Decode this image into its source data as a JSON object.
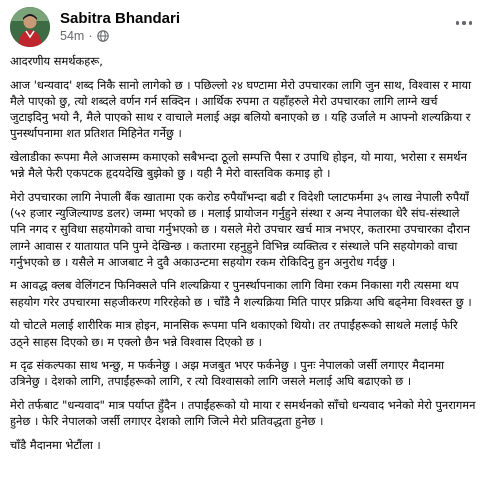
{
  "post": {
    "author": "Sabitra Bhandari",
    "timestamp": "54m",
    "separator": "·",
    "paragraphs": [
      "आदरणीय समर्थकहरू,",
      "आज 'धन्यवाद' शब्द निकै सानो लागेको छ । पछिल्लो २४ घण्टामा मेरो उपचारका लागि जुन साथ, विश्वास र माया मैले पाएको छु, त्यो शब्दले वर्णन गर्न सक्दिन । आर्थिक रुपमा त यहाँहरुले मेरो उपचारका लागि लाग्ने खर्च जुटाइदिनु भयो नै, मैले पाएको साथ र वाचाले मलाई अझ बलियो बनाएको छ । यहि उर्जाले म आफ्नो शल्यक्रिया र पुनर्स्थापनामा शत प्रतिशत मिहिनेत गर्नेछु ।",
      "खेलाडीका रूपमा मैले आजसम्म कमाएको सबैभन्दा ठूलो सम्पत्ति पैसा र उपाधि होइन, यो माया, भरोसा र समर्थन भन्ने मैले फेरी एकपटक हृदयदेखि बुझेको छु । यही नै मेरो वास्तविक कमाइ हो ।",
      "मेरो उपचारका लागि नेपाली बैंक खातामा एक करोड रुपैयाँभन्दा बढी र विदेशी प्लाटफर्ममा ३५ लाख नेपाली रुपैयाँ (५२ हजार न्युजिल्याण्ड डलर) जम्मा भएको छ । मलाई प्रायोजन गर्नुहुने संस्था र अन्य नेपालका धेरै संघ-संस्थाले पनि नगद र सुविधा सहयोगको वाचा गर्नुभएको छ । यसले मेरो उपचार खर्च मात्र नभएर, कतारमा उपचारका दौरान लाग्ने आवास र यातायात पनि पुग्ने देखिन्छ । कतारमा रहनुहुने विभिन्न व्यक्तित्व र संस्थाले पनि सहयोगको वाचा गर्नुभएको छ । यसैले म आजबाट ने दुवै अकाउन्टमा सहयोग रकम रोकिदिनु हुन अनुरोध गर्दछु ।",
      "म आवद्ध क्लब वेलिंगटन फिनिक्सले पनि शल्यक्रिया र पुनर्स्थापनाका लागि विमा रकम निकासा गरी त्यसमा थप सहयोग गरेर उपचारमा सहजीकरण गरिरहेको छ । चाँडै नै शल्यक्रिया मिति पाएर प्रक्रिया अघि बढ्नेमा विश्वस्त छु ।",
      "यो चोटले मलाई शारीरिक मात्र होइन, मानसिक रूपमा पनि थकाएको थियो। तर तपाईंहरूको साथले मलाई फेरि उठ्ने साहस दिएको छ। म एक्लो छैन भन्ने विश्वास दिएको छ ।",
      "म दृढ संकल्पका साथ भन्छु, म फर्कनेछु । अझ मजबुत भएर फर्कनेछु । पुनः नेपालको जर्सी लगाएर मैदानमा उत्रिनेछु । देशको लागि, तपाईंहरूको लागि, र त्यो विश्वासको लागि जसले मलाई अघि बढाएको छ ।",
      "मेरो तर्फबाट \"धन्यवाद\" मात्र पर्याप्त हुँदैन । तपाईंहरूको यो माया र समर्थनको साँचो धन्यवाद भनेको मेरो पुनरागमन हुनेछ । फेरि नेपालको जर्सी लगाएर देशको लागि जित्ने मेरो प्रतिवद्धता हुनेछ ।",
      "चाँडै मैदानमा भेटौंला ।"
    ]
  },
  "icons": {
    "globe": "globe-icon",
    "more": "more-options-icon"
  },
  "colors": {
    "text": "#050505",
    "meta": "#65676b",
    "background": "#ffffff"
  }
}
